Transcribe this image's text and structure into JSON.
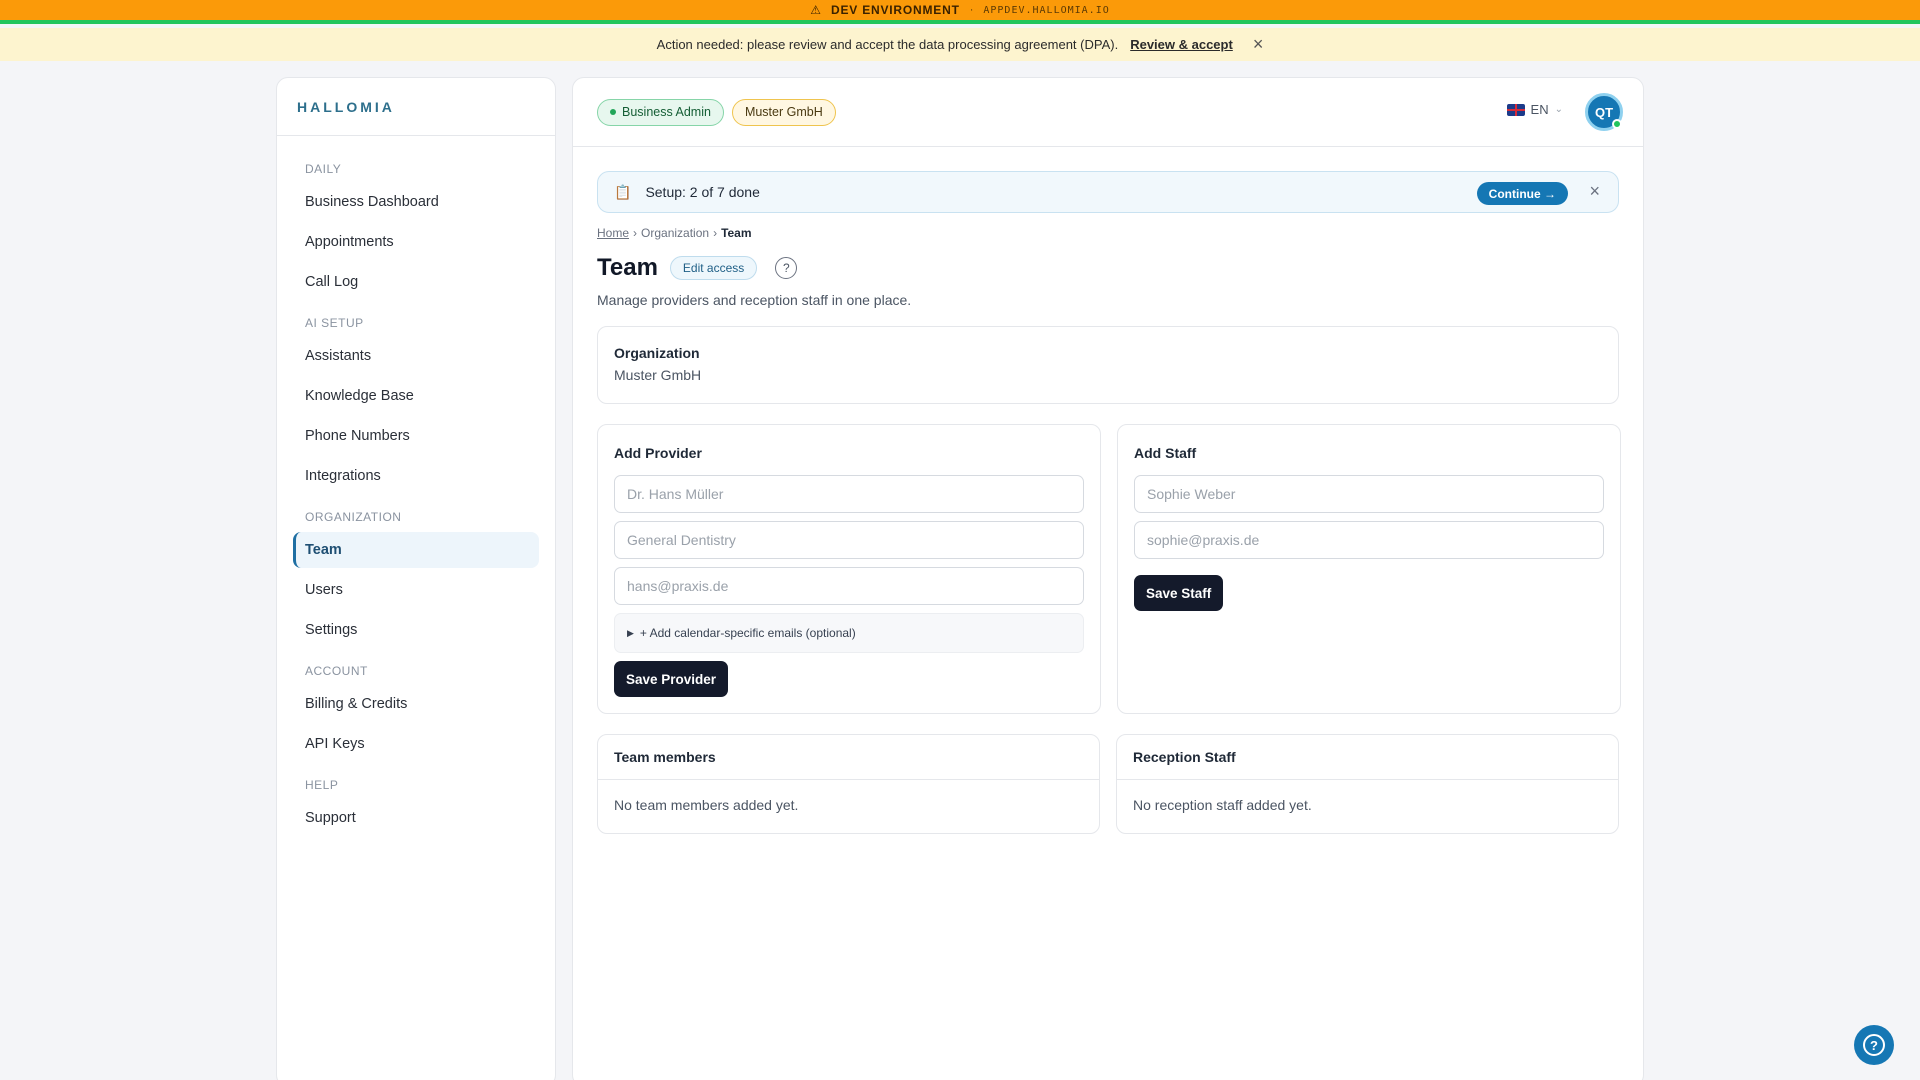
{
  "env": {
    "label": "DEV ENVIRONMENT",
    "separator": "·",
    "host": "APPDEV.HALLOMIA.IO"
  },
  "notice": {
    "text": "Action needed: please review and accept the data processing agreement (DPA).",
    "link": "Review & accept"
  },
  "sidebar": {
    "brand": "HALLOMIA",
    "sections": [
      {
        "title": "DAILY",
        "items": [
          "Business Dashboard",
          "Appointments",
          "Call Log"
        ]
      },
      {
        "title": "AI SETUP",
        "items": [
          "Assistants",
          "Knowledge Base",
          "Phone Numbers",
          "Integrations"
        ]
      },
      {
        "title": "ORGANIZATION",
        "items": [
          "Team",
          "Users",
          "Settings"
        ]
      },
      {
        "title": "ACCOUNT",
        "items": [
          "Billing & Credits",
          "API Keys"
        ]
      },
      {
        "title": "HELP",
        "items": [
          "Support"
        ]
      }
    ],
    "active_item": "Team"
  },
  "header": {
    "role_badge": "Business Admin",
    "org_badge": "Muster GmbH",
    "language": "EN",
    "avatar_initials": "QT"
  },
  "setup": {
    "text": "Setup: 2 of 7 done",
    "continue_label": "Continue →"
  },
  "breadcrumb": {
    "home": "Home",
    "organization": "Organization",
    "current": "Team",
    "sep": "›"
  },
  "page": {
    "title": "Team",
    "edit_access_label": "Edit access",
    "subtitle": "Manage providers and reception staff in one place."
  },
  "organization": {
    "label": "Organization",
    "value": "Muster GmbH"
  },
  "add_provider": {
    "title": "Add Provider",
    "name_placeholder": "Dr. Hans Müller",
    "specialty_placeholder": "General Dentistry",
    "email_placeholder": "hans@praxis.de",
    "calendar_emails_label": "+ Add calendar-specific emails (optional)",
    "save_label": "Save Provider"
  },
  "add_staff": {
    "title": "Add Staff",
    "name_placeholder": "Sophie Weber",
    "email_placeholder": "sophie@praxis.de",
    "save_label": "Save Staff"
  },
  "team_members": {
    "title": "Team members",
    "empty_text": "No team members added yet."
  },
  "reception_staff": {
    "title": "Reception Staff",
    "empty_text": "No reception staff added yet."
  },
  "colors": {
    "env_bar": "#fb9a09",
    "env_bar_border": "#22c55e",
    "notice_bg": "#fdf4cf",
    "brand": "#2d6f8c",
    "accent": "#1577b4",
    "dark_button": "#141a2b"
  },
  "icons": {
    "warning": "warning-icon",
    "close": "close-icon",
    "clipboard": "clipboard-icon",
    "help": "help-circle-icon",
    "flag": "uk-flag-icon"
  }
}
